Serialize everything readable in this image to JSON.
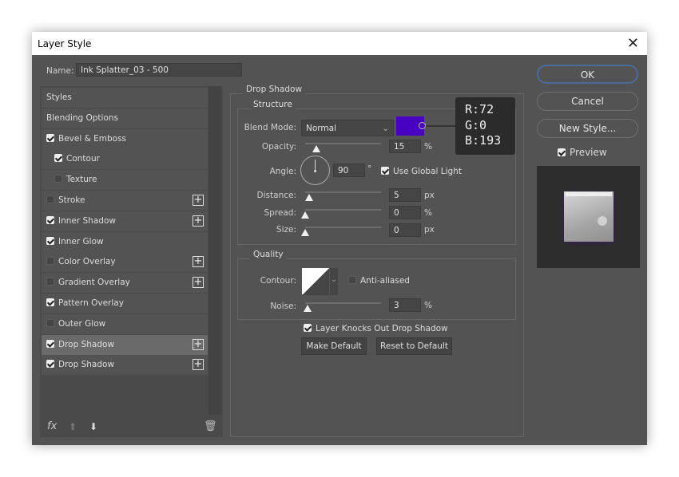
{
  "window": {
    "title": "Layer Style",
    "close_icon": "close-icon"
  },
  "name": {
    "label": "Name:",
    "value": "Ink Splatter_03 - 500"
  },
  "sidebar": {
    "items": [
      {
        "label": "Styles",
        "checkbox": null,
        "indent": 0,
        "plus": false
      },
      {
        "label": "Blending Options",
        "checkbox": null,
        "indent": 0,
        "plus": false
      },
      {
        "label": "Bevel & Emboss",
        "checkbox": true,
        "indent": 0,
        "plus": false
      },
      {
        "label": "Contour",
        "checkbox": true,
        "indent": 1,
        "plus": false
      },
      {
        "label": "Texture",
        "checkbox": false,
        "indent": 1,
        "plus": false
      },
      {
        "label": "Stroke",
        "checkbox": false,
        "indent": 0,
        "plus": true
      },
      {
        "label": "Inner Shadow",
        "checkbox": true,
        "indent": 0,
        "plus": true
      },
      {
        "label": "Inner Glow",
        "checkbox": true,
        "indent": 0,
        "plus": false
      },
      {
        "label": "Color Overlay",
        "checkbox": false,
        "indent": 0,
        "plus": true
      },
      {
        "label": "Gradient Overlay",
        "checkbox": false,
        "indent": 0,
        "plus": true
      },
      {
        "label": "Pattern Overlay",
        "checkbox": true,
        "indent": 0,
        "plus": false
      },
      {
        "label": "Outer Glow",
        "checkbox": false,
        "indent": 0,
        "plus": false
      },
      {
        "label": "Drop Shadow",
        "checkbox": true,
        "indent": 0,
        "plus": true,
        "selected": true
      },
      {
        "label": "Drop Shadow",
        "checkbox": true,
        "indent": 0,
        "plus": true
      }
    ],
    "footer": {
      "fx": "fx",
      "icons": [
        "fx-icon",
        "arrow-up-icon",
        "arrow-down-icon",
        "trash-icon"
      ]
    }
  },
  "panel": {
    "title": "Drop Shadow",
    "structure": {
      "title": "Structure",
      "blend_mode": {
        "label": "Blend Mode:",
        "value": "Normal"
      },
      "color": "#4800c1",
      "color_tooltip": {
        "r": "R:72",
        "g": "G:0",
        "b": "B:193"
      },
      "opacity": {
        "label": "Opacity:",
        "value": "15",
        "unit": "%",
        "level": 15
      },
      "angle": {
        "label": "Angle:",
        "value": "90",
        "unit": "°"
      },
      "use_global_light": {
        "label": "Use Global Light",
        "checked": true
      },
      "distance": {
        "label": "Distance:",
        "value": "5",
        "unit": "px",
        "level": 5
      },
      "spread": {
        "label": "Spread:",
        "value": "0",
        "unit": "%",
        "level": 0
      },
      "size": {
        "label": "Size:",
        "value": "0",
        "unit": "px",
        "level": 0
      }
    },
    "quality": {
      "title": "Quality",
      "contour": {
        "label": "Contour:"
      },
      "anti_aliased": {
        "label": "Anti-aliased",
        "checked": false
      },
      "noise": {
        "label": "Noise:",
        "value": "3",
        "unit": "%",
        "level": 3
      }
    },
    "knockout": {
      "label": "Layer Knocks Out Drop Shadow",
      "checked": true
    },
    "make_default": "Make Default",
    "reset_default": "Reset to Default"
  },
  "actions": {
    "ok": "OK",
    "cancel": "Cancel",
    "new_style": "New Style...",
    "preview": {
      "label": "Preview",
      "checked": true
    }
  }
}
